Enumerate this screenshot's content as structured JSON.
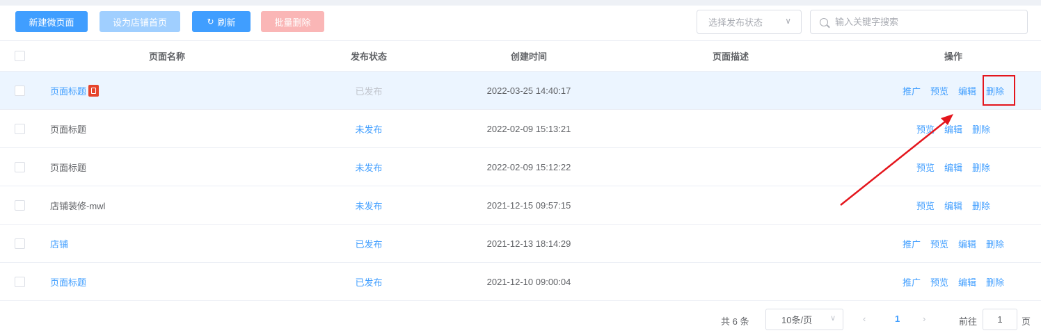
{
  "toolbar": {
    "new_label": "新建微页面",
    "set_home_label": "设为店铺首页",
    "refresh_label": "刷新",
    "batch_delete_label": "批量删除",
    "status_select_placeholder": "选择发布状态",
    "search_placeholder": "输入关键字搜索"
  },
  "table": {
    "headers": {
      "name": "页面名称",
      "status": "发布状态",
      "created": "创建时间",
      "desc": "页面描述",
      "ops": "操作"
    },
    "ops_labels": {
      "promote": "推广",
      "preview": "预览",
      "edit": "编辑",
      "delete": "删除"
    },
    "rows": [
      {
        "name": "页面标题",
        "status": "已发布",
        "created": "2022-03-25 14:40:17",
        "desc": ""
      },
      {
        "name": "页面标题",
        "status": "未发布",
        "created": "2022-02-09 15:13:21",
        "desc": ""
      },
      {
        "name": "页面标题",
        "status": "未发布",
        "created": "2022-02-09 15:12:22",
        "desc": ""
      },
      {
        "name": "店铺装修-mwl",
        "status": "未发布",
        "created": "2021-12-15 09:57:15",
        "desc": ""
      },
      {
        "name": "店铺",
        "status": "已发布",
        "created": "2021-12-13 18:14:29",
        "desc": ""
      },
      {
        "name": "页面标题",
        "status": "已发布",
        "created": "2021-12-10 09:00:04",
        "desc": ""
      }
    ]
  },
  "pagination": {
    "total": "共 6 条",
    "page_size": "10条/页",
    "current_page": "1",
    "goto_label": "前往",
    "goto_value": "1",
    "page_unit": "页"
  },
  "colors": {
    "primary": "#409eff",
    "highlight_row": "#ecf5ff",
    "annotation": "#e4151c",
    "danger_light": "#fab6b6"
  }
}
